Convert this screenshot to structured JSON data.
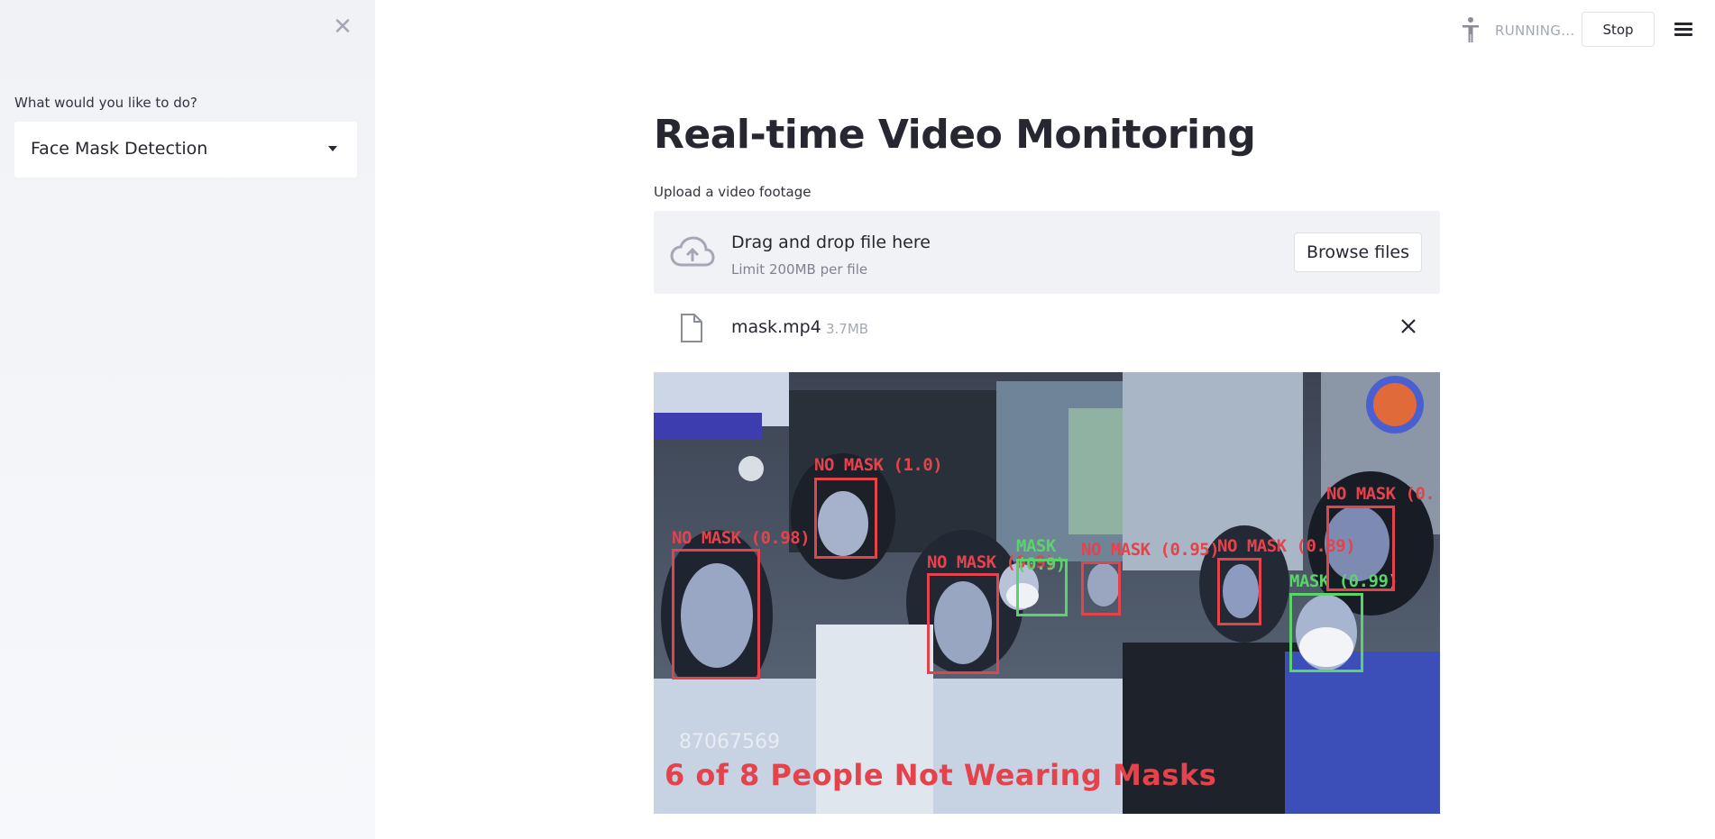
{
  "sidebar": {
    "question_label": "What would you like to do?",
    "selected_option": "Face Mask Detection"
  },
  "toolbar": {
    "status_text": "RUNNING...",
    "stop_label": "Stop"
  },
  "main": {
    "title": "Real-time Video Monitoring",
    "uploader": {
      "label": "Upload a video footage",
      "drop_text": "Drag and drop file here",
      "limit_text": "Limit 200MB per file",
      "browse_label": "Browse files"
    },
    "file": {
      "name": "mask.mp4",
      "size": "3.7MB"
    },
    "video": {
      "frame_id": "87067569",
      "summary": "6 of 8 People Not Wearing Masks",
      "detections": [
        {
          "label": "NO MASK (1.0)",
          "status": "no_mask"
        },
        {
          "label": "NO MASK (0.98)",
          "status": "no_mask"
        },
        {
          "label": "NO MASK (0.9)",
          "status": "no_mask"
        },
        {
          "label": "MASK (0.9)",
          "status": "mask"
        },
        {
          "label": "NO MASK (0.95)",
          "status": "no_mask"
        },
        {
          "label": "NO MASK (0.89)",
          "status": "no_mask"
        },
        {
          "label": "MASK (0.99)",
          "status": "mask"
        },
        {
          "label": "NO MASK (0.",
          "status": "no_mask"
        }
      ]
    }
  },
  "colors": {
    "no_mask": "#e4434c",
    "mask": "#5ad36a",
    "sidebar_bg": "#f0f2f6",
    "dropzone_bg": "#f0f2f6"
  }
}
